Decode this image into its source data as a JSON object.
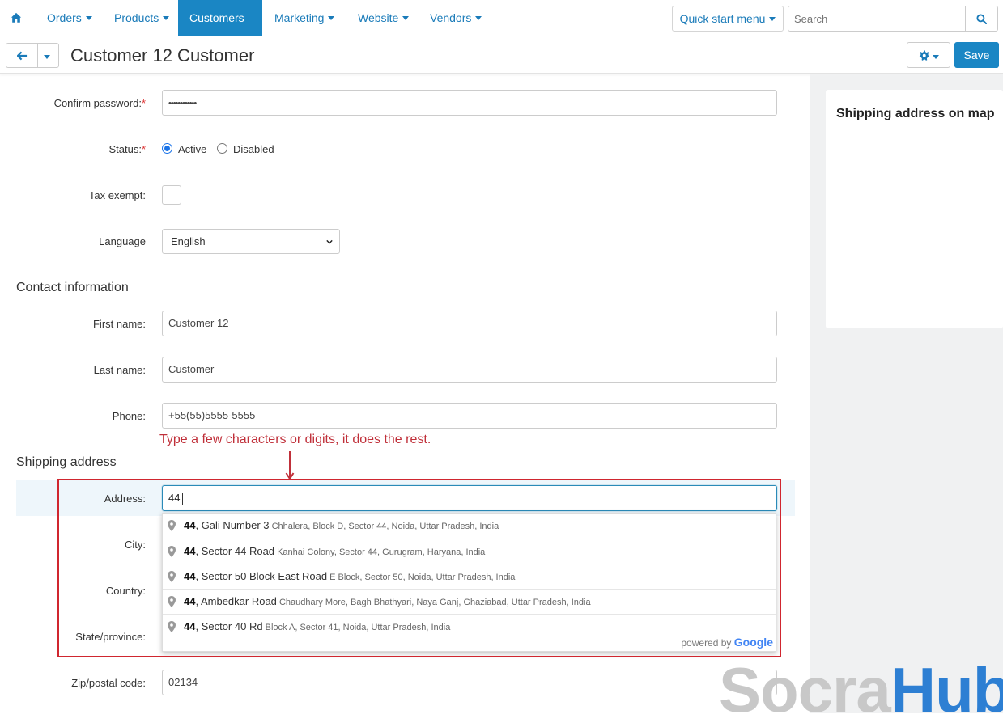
{
  "nav": {
    "items": [
      {
        "label": "Orders"
      },
      {
        "label": "Products"
      },
      {
        "label": "Customers"
      },
      {
        "label": "Marketing"
      },
      {
        "label": "Website"
      },
      {
        "label": "Vendors"
      }
    ],
    "quick_start": "Quick start menu",
    "search_placeholder": "Search"
  },
  "header": {
    "title": "Customer 12 Customer",
    "save_label": "Save"
  },
  "sidebar": {
    "map_title": "Shipping address on map"
  },
  "form": {
    "confirm_password_label": "Confirm password:",
    "confirm_password_value": "••••••••••••",
    "status_label": "Status:",
    "status_active": "Active",
    "status_disabled": "Disabled",
    "tax_exempt_label": "Tax exempt:",
    "language_label": "Language",
    "language_value": "English",
    "contact_section": "Contact information",
    "first_name_label": "First name:",
    "first_name_value": "Customer 12",
    "last_name_label": "Last name:",
    "last_name_value": "Customer",
    "phone_label": "Phone:",
    "phone_value": "+55(55)5555-5555",
    "shipping_section": "Shipping address",
    "address_label": "Address:",
    "address_value": "44",
    "city_label": "City:",
    "country_label": "Country:",
    "state_label": "State/province:",
    "zip_label": "Zip/postal code:",
    "zip_value": "02134"
  },
  "annotation": "Type a few characters or digits, it does the rest.",
  "suggestions": [
    {
      "match": "44",
      "main": ", Gali Number 3",
      "secondary": "Chhalera, Block D, Sector 44, Noida, Uttar Pradesh, India"
    },
    {
      "match": "44",
      "main": ", Sector 44 Road",
      "secondary": "Kanhai Colony, Sector 44, Gurugram, Haryana, India"
    },
    {
      "match": "44",
      "main": ", Sector 50 Block East Road",
      "secondary": "E Block, Sector 50, Noida, Uttar Pradesh, India"
    },
    {
      "match": "44",
      "main": ", Ambedkar Road",
      "secondary": "Chaudhary More, Bagh Bhathyari, Naya Ganj, Ghaziabad, Uttar Pradesh, India"
    },
    {
      "match": "44",
      "main": ", Sector 40 Rd",
      "secondary": "Block A, Sector 41, Noida, Uttar Pradesh, India"
    }
  ],
  "powered_by": "powered by",
  "powered_brand": "Google",
  "watermark": {
    "part1": "Socra",
    "part2": "Hub"
  }
}
